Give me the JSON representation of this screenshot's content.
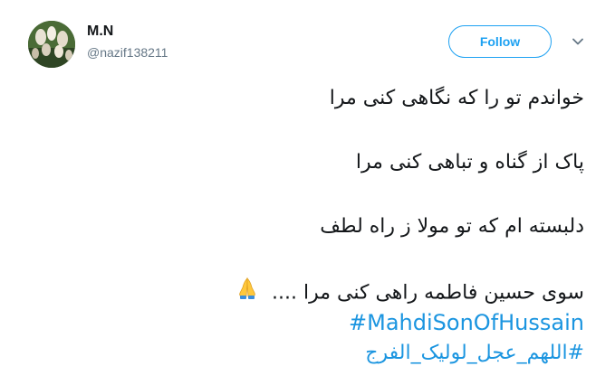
{
  "author": {
    "display_name": "M.N",
    "handle": "@nazif138211",
    "avatar_icon": "avatar-photo"
  },
  "actions": {
    "follow_label": "Follow",
    "menu_icon": "chevron-down-icon"
  },
  "tweet": {
    "lines": [
      "خواندم تو را که نگاهی کنی مرا",
      "پاک از گناه و تباهی کنی مرا",
      "دلبسته ام که تو مولا ز راه لطف",
      "سوی حسین فاطمه راهی کنی مرا ...."
    ],
    "emoji_icon": "folded-hands-icon",
    "hashtags": [
      "#MahdiSonOfHussain",
      "#اللهم_عجل_لولیک_الفرج"
    ]
  },
  "colors": {
    "accent": "#1da1f2",
    "link": "#1b95e0",
    "text": "#14171a",
    "muted": "#657786"
  }
}
